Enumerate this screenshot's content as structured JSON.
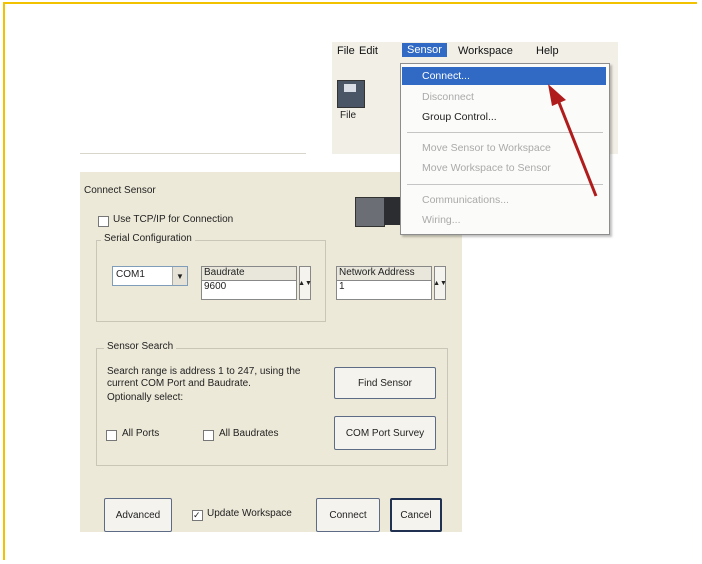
{
  "menubar": {
    "items": [
      "File",
      "Edit",
      "Sensor",
      "Workspace",
      "Help"
    ],
    "active": "Sensor"
  },
  "toolbar": {
    "file_label": "File"
  },
  "sensor_menu": {
    "items": [
      {
        "label": "Connect...",
        "state": "highlighted"
      },
      {
        "label": "Disconnect",
        "state": "disabled"
      },
      {
        "label": "Group Control...",
        "state": "enabled"
      },
      {
        "label": "Move Sensor to Workspace",
        "state": "disabled"
      },
      {
        "label": "Move Workspace to Sensor",
        "state": "disabled"
      },
      {
        "label": "Communications...",
        "state": "disabled"
      },
      {
        "label": "Wiring...",
        "state": "disabled"
      }
    ]
  },
  "dialog": {
    "title": "Connect Sensor",
    "use_tcpip_label": "Use TCP/IP for Connection",
    "use_tcpip_checked": false,
    "serial_group_label": "Serial Configuration",
    "com_port_value": "COM1",
    "baudrate_header": "Baudrate",
    "baudrate_value": "9600",
    "network_address_header": "Network Address",
    "network_address_value": "1",
    "search_group_label": "Sensor Search",
    "search_description": "Search range is address 1 to 247, using the current COM Port and Baudrate.",
    "optionally_select_label": "Optionally select:",
    "all_ports_label": "All Ports",
    "all_baudrates_label": "All Baudrates",
    "find_sensor_label": "Find Sensor",
    "com_port_survey_label": "COM Port Survey",
    "advanced_label": "Advanced",
    "update_workspace_label": "Update Workspace",
    "update_workspace_checked": true,
    "connect_label": "Connect",
    "cancel_label": "Cancel"
  },
  "colors": {
    "frame_border": "#f2c200",
    "highlight": "#316ac5",
    "arrow": "#b01c1c",
    "dialog_bg": "#ece9d8"
  }
}
